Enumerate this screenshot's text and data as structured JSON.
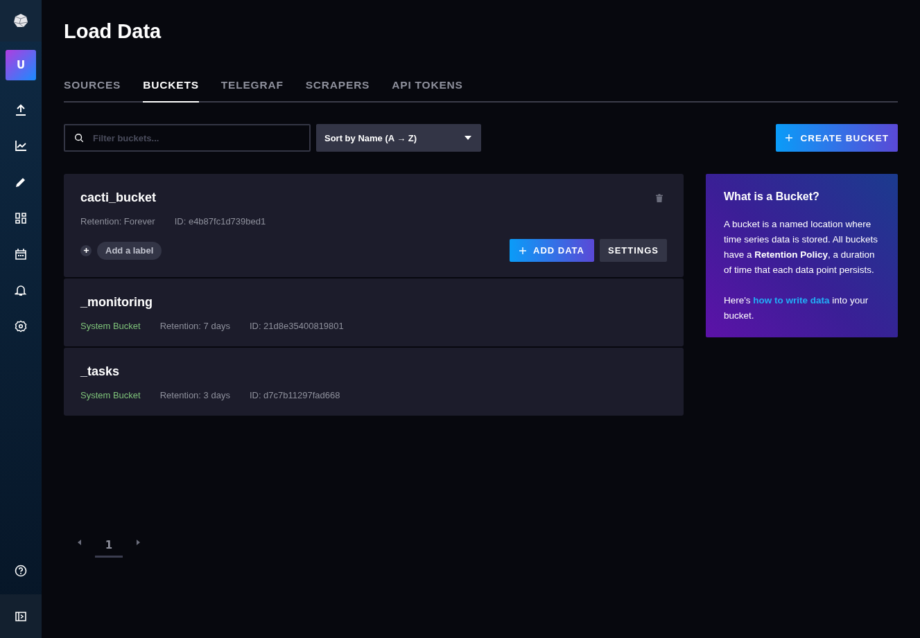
{
  "sidebar": {
    "avatar": "U",
    "items": [
      {
        "selected": false
      },
      {
        "selected": false
      },
      {
        "selected": false
      },
      {
        "selected": false
      },
      {
        "selected": false
      },
      {
        "selected": false
      },
      {
        "selected": false
      }
    ]
  },
  "page": {
    "title": "Load Data"
  },
  "tabs": [
    {
      "label": "SOURCES",
      "selected": false
    },
    {
      "label": "BUCKETS",
      "selected": true
    },
    {
      "label": "TELEGRAF",
      "selected": false
    },
    {
      "label": "SCRAPERS",
      "selected": false
    },
    {
      "label": "API TOKENS",
      "selected": false
    }
  ],
  "toolbar": {
    "search": {
      "placeholder": "Filter buckets..."
    },
    "sort": "Sort by Name (A → Z)",
    "create_button": "CREATE BUCKET"
  },
  "buckets": [
    {
      "kind": "user",
      "name": "cacti_bucket",
      "retention": "Retention: Forever",
      "id": "ID: e4b87fc1d739bed1",
      "add_label": "Add a label",
      "add_data": "ADD DATA",
      "settings": "SETTINGS"
    },
    {
      "kind": "system",
      "name": "_monitoring",
      "badge": "System Bucket",
      "retention": "Retention: 7 days",
      "id": "ID: 21d8e35400819801"
    },
    {
      "kind": "system",
      "name": "_tasks",
      "badge": "System Bucket",
      "retention": "Retention: 3 days",
      "id": "ID: d7c7b11297fad668"
    }
  ],
  "info": {
    "title": "What is a Bucket?",
    "text": "A bucket is a named location where time series data is stored. All buckets have a **Retention Policy**, a duration of time that each data point persists.",
    "link_before": "Here's",
    "link": "how to write data",
    "link_after": "into your bucket."
  },
  "pagination": {
    "pages": [
      {
        "label": "1",
        "selected": true
      }
    ]
  }
}
